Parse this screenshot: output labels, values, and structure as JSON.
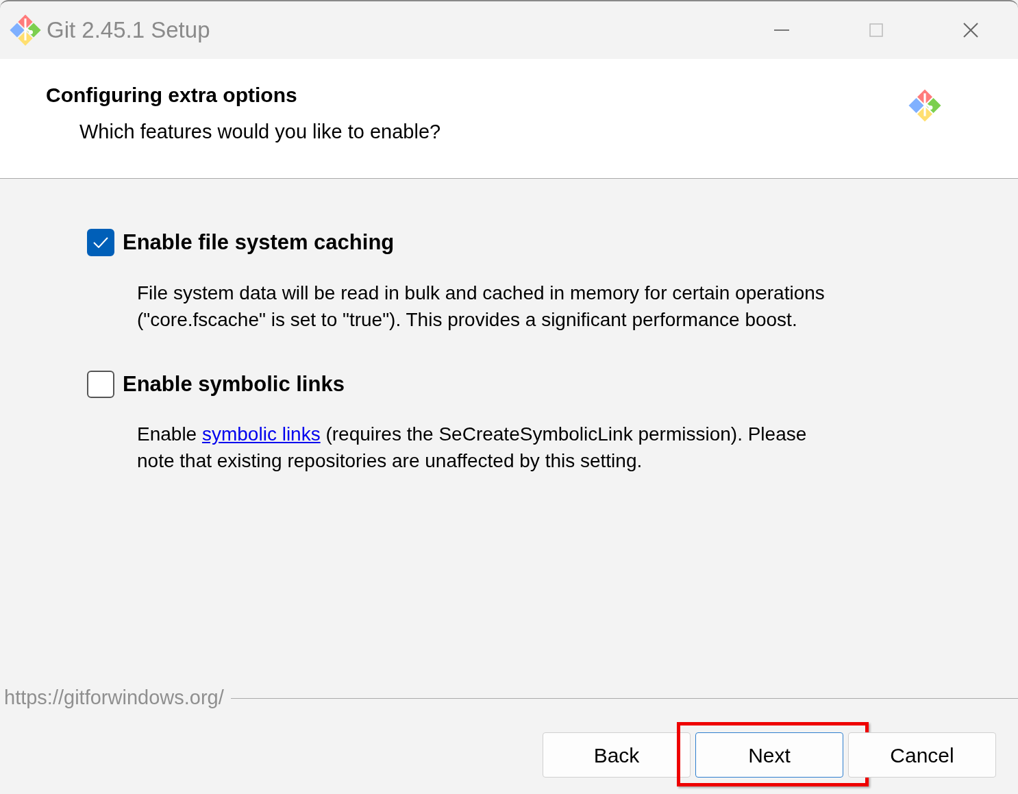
{
  "window": {
    "title": "Git 2.45.1 Setup"
  },
  "header": {
    "title": "Configuring extra options",
    "subtitle": "Which features would you like to enable?"
  },
  "options": [
    {
      "label": "Enable file system caching",
      "checked": true,
      "description": [
        {
          "kind": "text",
          "text": "File system data will be read in bulk and cached in memory for certain operations (\"core.fscache\" is set to \"true\"). This provides a significant performance boost."
        }
      ]
    },
    {
      "label": "Enable symbolic links",
      "checked": false,
      "description": [
        {
          "kind": "text",
          "text": "Enable "
        },
        {
          "kind": "link",
          "text": "symbolic links"
        },
        {
          "kind": "text",
          "text": " (requires the SeCreateSymbolicLink permission). Please note that existing repositories are unaffected by this setting."
        }
      ]
    }
  ],
  "footer": {
    "url": "https://gitforwindows.org/"
  },
  "buttons": [
    {
      "label": "Back",
      "default": false,
      "highlighted": false
    },
    {
      "label": "Next",
      "default": true,
      "highlighted": true
    },
    {
      "label": "Cancel",
      "default": false,
      "highlighted": false
    }
  ]
}
